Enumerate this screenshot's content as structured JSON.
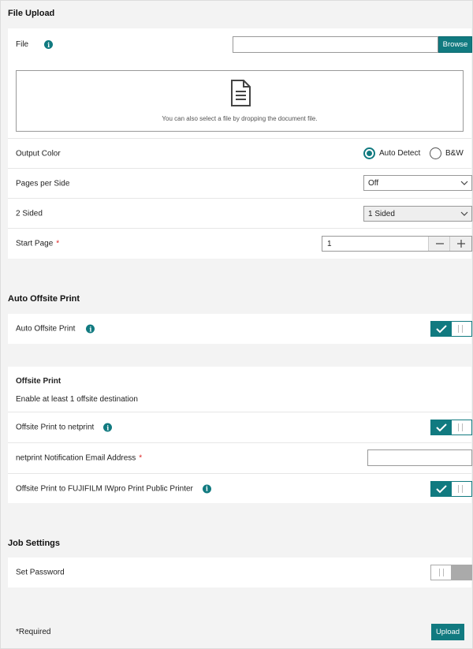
{
  "file_upload": {
    "title": "File Upload",
    "file_label": "File",
    "file_value": "",
    "browse_label": "Browse",
    "drop_text": "You can also select a file by dropping the document file.",
    "output_color_label": "Output Color",
    "color_options": [
      "Auto Detect",
      "B&W"
    ],
    "color_selected": "Auto Detect",
    "pages_per_side_label": "Pages per Side",
    "pages_per_side_value": "Off",
    "two_sided_label": "2 Sided",
    "two_sided_value": "1 Sided",
    "start_page_label": "Start Page",
    "start_page_value": "1",
    "required_mark": "*"
  },
  "auto_offsite": {
    "title": "Auto Offsite Print",
    "toggle_label": "Auto Offsite Print",
    "toggle_on": true
  },
  "offsite": {
    "title": "Offsite Print",
    "subtitle": "Enable at least 1 offsite destination",
    "netprint_label": "Offsite Print to netprint",
    "netprint_on": true,
    "email_label": "netprint Notification Email Address",
    "email_value": "",
    "fujifilm_label": "Offsite Print to FUJIFILM IWpro Print Public Printer",
    "fujifilm_on": true
  },
  "job_settings": {
    "title": "Job Settings",
    "password_label": "Set Password",
    "password_on": false
  },
  "footer": {
    "required_note": "*Required",
    "upload_label": "Upload"
  },
  "colors": {
    "accent": "#117a80",
    "required": "#dd2222"
  }
}
